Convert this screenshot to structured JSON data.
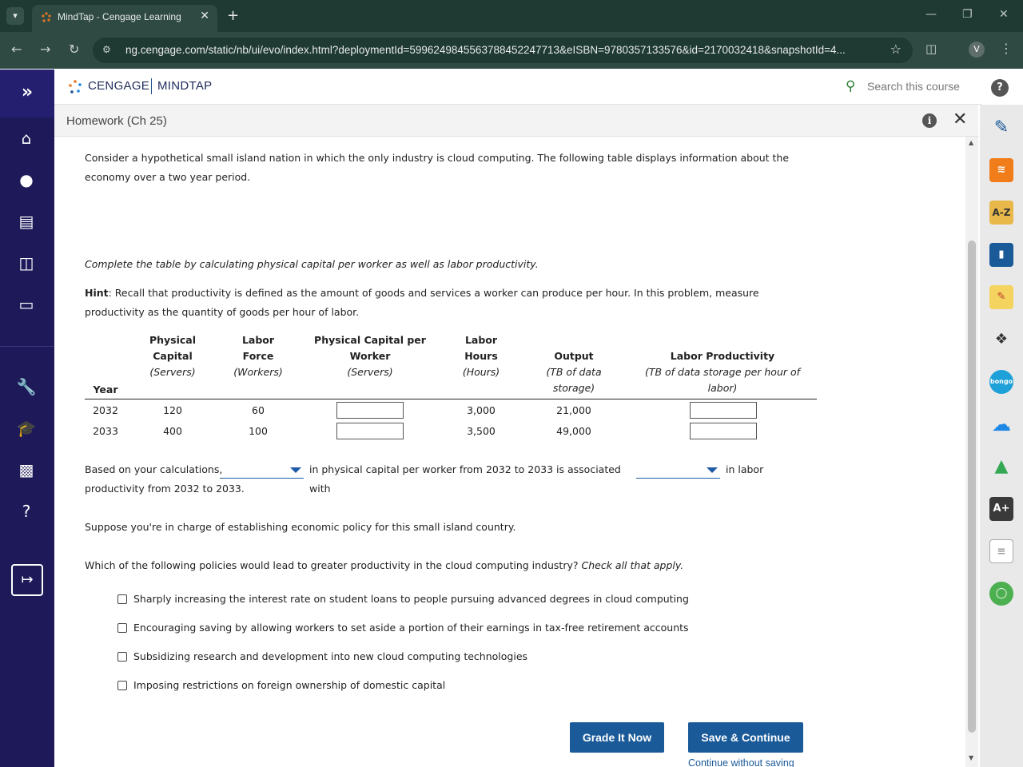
{
  "browser": {
    "tab_title": "MindTap - Cengage Learning",
    "url": "ng.cengage.com/static/nb/ui/evo/index.html?deploymentId=5996249845563788452247713&eISBN=9780357133576&id=2170032418&snapshotId=4...",
    "avatar_letter": "V"
  },
  "header": {
    "brand_left": "CENGAGE",
    "brand_right": "MINDTAP",
    "search_placeholder": "Search this course"
  },
  "titlebar": {
    "title": "Homework (Ch 25)"
  },
  "content": {
    "intro": "Consider a hypothetical small island nation in which the only industry is cloud computing. The following table displays information about the economy over a two year period.",
    "instruction": "Complete the table by calculating physical capital per worker as well as labor productivity.",
    "hint_label": "Hint",
    "hint_text": ": Recall that productivity is defined as the amount of goods and services a worker can produce per hour. In this problem, measure productivity as the quantity of goods per hour of labor.",
    "table": {
      "year_header": "Year",
      "columns": [
        {
          "line1": "Physical",
          "line2": "Capital",
          "unit": "(Servers)"
        },
        {
          "line1": "Labor",
          "line2": "Force",
          "unit": "(Workers)"
        },
        {
          "line1": "Physical Capital per",
          "line2": "Worker",
          "unit": "(Servers)"
        },
        {
          "line1": "Labor",
          "line2": "Hours",
          "unit": "(Hours)"
        },
        {
          "line1": "",
          "line2": "Output",
          "unit": "(TB of data",
          "unit2": "storage)"
        },
        {
          "line1": "",
          "line2": "Labor Productivity",
          "unit": "(TB of data storage per hour of",
          "unit2": "labor)"
        }
      ],
      "rows": [
        {
          "year": "2032",
          "capital": "120",
          "labor_force": "60",
          "capital_per_worker": "",
          "hours": "3,000",
          "output": "21,000",
          "productivity": ""
        },
        {
          "year": "2033",
          "capital": "400",
          "labor_force": "100",
          "capital_per_worker": "",
          "hours": "3,500",
          "output": "49,000",
          "productivity": ""
        }
      ]
    },
    "sentence_part1": "Based on your calculations,",
    "sentence_part2": "in physical capital per worker from 2032 to 2033 is associated with",
    "sentence_part3": "in labor",
    "sentence_part4": "productivity from 2032 to 2033.",
    "policy_intro": "Suppose you're in charge of establishing economic policy for this small island country.",
    "question": "Which of the following policies would lead to greater productivity in the cloud computing industry?",
    "question_suffix": "Check all that apply.",
    "options": [
      "Sharply increasing the interest rate on student loans to people pursuing advanced degrees in cloud computing",
      "Encouraging saving by allowing workers to set aside a portion of their earnings in tax-free retirement accounts",
      "Subsidizing research and development into new cloud computing technologies",
      "Imposing restrictions on foreign ownership of domestic capital"
    ],
    "grade_button": "Grade It Now",
    "save_button": "Save & Continue",
    "continue_link": "Continue without saving"
  },
  "rail": {
    "az_label": "A-Z",
    "bongo_label": "bongo",
    "aplus_label": "A+"
  },
  "colors": {
    "nav_bg": "#1e1a5a",
    "button_bg": "#1a5a99",
    "browser_bg": "#1f3a33"
  }
}
